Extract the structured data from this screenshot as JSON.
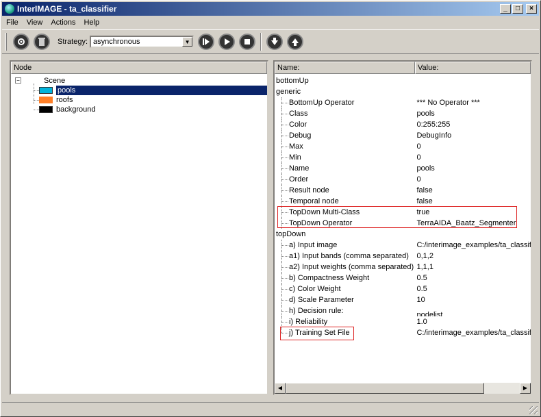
{
  "window": {
    "title": "InterIMAGE - ta_classifier",
    "minimize": "_",
    "maximize": "□",
    "close": "×"
  },
  "menu": [
    "File",
    "View",
    "Actions",
    "Help"
  ],
  "toolbar": {
    "strategy_label": "Strategy:",
    "strategy_value": "asynchronous",
    "icons": [
      "settings-icon",
      "trash-icon",
      "step-icon",
      "play-icon",
      "stop-icon",
      "download-icon",
      "upload-icon"
    ]
  },
  "left": {
    "header": "Node",
    "root": "Scene",
    "nodes": [
      {
        "label": "pools",
        "color": "#00b4dc"
      },
      {
        "label": "roofs",
        "color": "#ff7f27"
      },
      {
        "label": "background",
        "color": "#000000"
      }
    ]
  },
  "right": {
    "header_name": "Name:",
    "header_value": "Value:",
    "sections": [
      {
        "label": "bottomUp",
        "rows": []
      },
      {
        "label": "generic",
        "rows": [
          {
            "name": "BottomUp Operator",
            "value": "*** No Operator ***"
          },
          {
            "name": "Class",
            "value": "pools"
          },
          {
            "name": "Color",
            "value": "0:255:255"
          },
          {
            "name": "Debug",
            "value": "DebugInfo"
          },
          {
            "name": "Max",
            "value": "0"
          },
          {
            "name": "Min",
            "value": "0"
          },
          {
            "name": "Name",
            "value": "pools"
          },
          {
            "name": "Order",
            "value": "0"
          },
          {
            "name": "Result node",
            "value": "false"
          },
          {
            "name": "Temporal node",
            "value": "false"
          },
          {
            "name": "TopDown Multi-Class",
            "value": "true"
          },
          {
            "name": "TopDown Operator",
            "value": "TerraAIDA_Baatz_Segmenter"
          }
        ]
      },
      {
        "label": "topDown",
        "rows": [
          {
            "name": "a) Input image",
            "value": "C:/interimage_examples/ta_classifier"
          },
          {
            "name": "a1) Input bands (comma separated)",
            "value": "0,1,2"
          },
          {
            "name": "a2) Input weights (comma separated)",
            "value": "1,1,1"
          },
          {
            "name": "b) Compactness Weight",
            "value": "0.5"
          },
          {
            "name": "c) Color Weight",
            "value": "0.5"
          },
          {
            "name": "d) Scale Parameter",
            "value": "10"
          },
          {
            "name": "h) Decision rule:",
            "value": "nodelist"
          },
          {
            "name": "i) Reliability",
            "value": "1.0"
          },
          {
            "name": "j) Training Set File",
            "value": "C:/interimage_examples/ta_classifier"
          }
        ]
      }
    ]
  }
}
